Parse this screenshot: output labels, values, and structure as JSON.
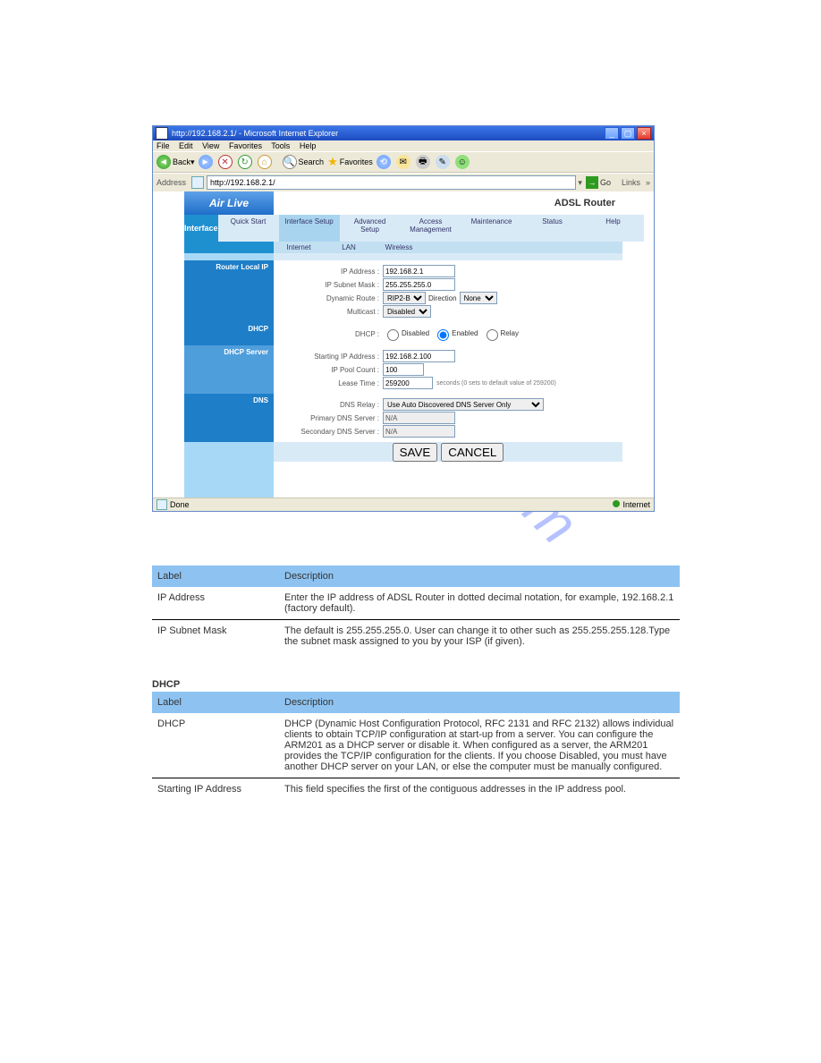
{
  "ie": {
    "title": "http://192.168.2.1/ - Microsoft Internet Explorer",
    "menu": {
      "file": "File",
      "edit": "Edit",
      "view": "View",
      "favorites": "Favorites",
      "tools": "Tools",
      "help": "Help"
    },
    "toolbar": {
      "back": "Back",
      "search": "Search",
      "favorites": "Favorites"
    },
    "address_label": "Address",
    "address_value": "http://192.168.2.1/",
    "go": "Go",
    "links": "Links",
    "status_done": "Done",
    "status_zone": "Internet"
  },
  "router": {
    "brand": "Air Live",
    "title": "ADSL Router",
    "sidebar": "Interface",
    "tabs": [
      "Quick Start",
      "Interface Setup",
      "Advanced Setup",
      "Access Management",
      "Maintenance",
      "Status",
      "Help"
    ],
    "subtabs": [
      "Internet",
      "LAN",
      "Wireless"
    ],
    "sections": {
      "router_local_ip": "Router Local IP",
      "dhcp": "DHCP",
      "dhcp_server": "DHCP Server",
      "dns": "DNS"
    },
    "form": {
      "ip_address": {
        "label": "IP Address :",
        "value": "192.168.2.1"
      },
      "subnet_mask": {
        "label": "IP Subnet Mask :",
        "value": "255.255.255.0"
      },
      "dynamic_route": {
        "label": "Dynamic Route :",
        "value": "RIP2-B",
        "direction_label": "Direction",
        "direction_value": "None"
      },
      "multicast": {
        "label": "Multicast :",
        "value": "Disabled"
      },
      "dhcp": {
        "label": "DHCP :",
        "disabled": "Disabled",
        "enabled": "Enabled",
        "relay": "Relay"
      },
      "starting_ip": {
        "label": "Starting IP Address :",
        "value": "192.168.2.100"
      },
      "pool_count": {
        "label": "IP Pool Count :",
        "value": "100"
      },
      "lease_time": {
        "label": "Lease Time :",
        "value": "259200",
        "note": "seconds (0 sets to default value of 259200)"
      },
      "dns_relay": {
        "label": "DNS Relay :",
        "value": "Use Auto Discovered DNS Server Only"
      },
      "primary_dns": {
        "label": "Primary DNS Server :",
        "value": "N/A"
      },
      "secondary_dns": {
        "label": "Secondary DNS Server :",
        "value": "N/A"
      }
    },
    "save": "SAVE",
    "cancel": "CANCEL"
  },
  "watermark": "manualshive.com",
  "doc": {
    "router_local_ip": {
      "header_label": "Label",
      "header_desc": "Description",
      "rows": [
        {
          "label": "IP Address",
          "desc": "Enter the IP address of ADSL Router in dotted decimal notation, for example, 192.168.2.1 (factory default)."
        },
        {
          "label": "IP Subnet Mask",
          "desc": "The default is 255.255.255.0. User can change it to other such as 255.255.255.128.Type the subnet mask assigned to you by your ISP (if given)."
        }
      ]
    },
    "dhcp_section_title": "DHCP",
    "dhcp": {
      "header_label": "Label",
      "header_desc": "Description",
      "rows": [
        {
          "label": "DHCP",
          "desc": "DHCP (Dynamic Host Configuration Protocol, RFC 2131 and RFC 2132) allows individual clients to obtain TCP/IP configuration at start-up from a server. You can configure the ARM201 as a DHCP server or disable it. When configured as a server, the ARM201 provides the TCP/IP configuration for the clients. If you choose Disabled, you must have another DHCP server on your LAN, or else the computer must be manually configured."
        },
        {
          "label": "Starting IP Address",
          "desc": "This field specifies the first of the contiguous addresses in the IP address pool."
        }
      ]
    }
  }
}
